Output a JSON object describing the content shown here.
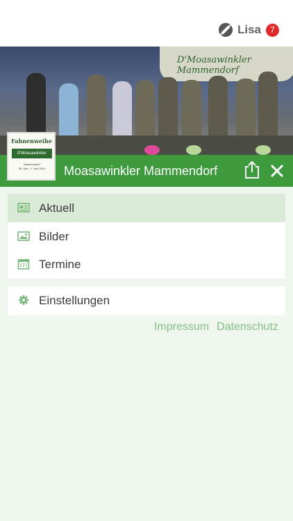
{
  "header": {
    "user_name": "Lisa",
    "notification_count": "7",
    "user_logo_icon": "app-logo-icon"
  },
  "hero": {
    "banner_text": "D'Moasawinkler Mammendorf"
  },
  "club": {
    "name": "Moasawinkler Mammendorf",
    "logo_text": {
      "top": "Fahnenweihe",
      "ribbon": "D'Moasawinkler",
      "sub": "Mammendorf",
      "dates": "30. Mai - 1. Juni 2014"
    },
    "actions": {
      "share_icon": "share-icon",
      "close_icon": "close-icon"
    }
  },
  "menu": {
    "items": [
      {
        "label": "Aktuell",
        "icon": "newspaper-icon",
        "active": true
      },
      {
        "label": "Bilder",
        "icon": "image-icon",
        "active": false
      },
      {
        "label": "Termine",
        "icon": "calendar-icon",
        "active": false
      }
    ],
    "settings": {
      "label": "Einstellungen",
      "icon": "gear-icon"
    }
  },
  "footer": {
    "impressum": "Impressum",
    "datenschutz": "Datenschutz"
  },
  "colors": {
    "accent_green": "#3d9a3d",
    "active_row": "#d9ebd6",
    "link_green": "#86bf86",
    "badge_red": "#e02a2a",
    "page_bg": "#eef6ee"
  }
}
